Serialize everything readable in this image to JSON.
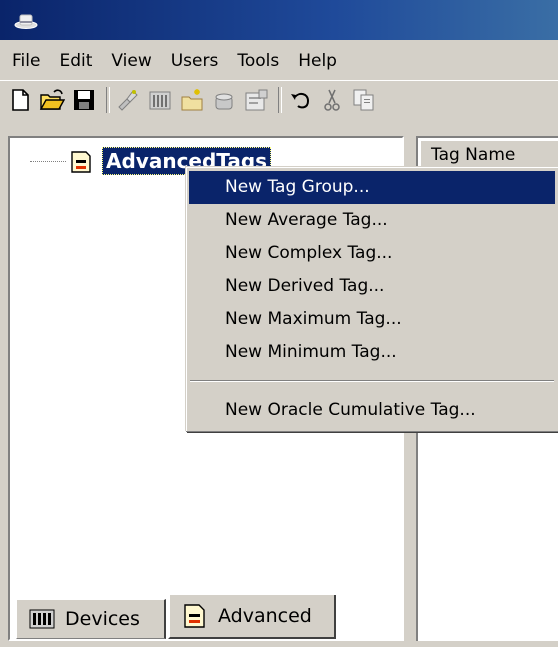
{
  "titlebar": {
    "icon": "app-hat-icon",
    "color": "#0a246a"
  },
  "menubar": {
    "items": [
      {
        "label": "File"
      },
      {
        "label": "Edit"
      },
      {
        "label": "View"
      },
      {
        "label": "Users"
      },
      {
        "label": "Tools"
      },
      {
        "label": "Help"
      }
    ]
  },
  "toolbar": {
    "buttons": [
      {
        "icon": "new-document-icon"
      },
      {
        "icon": "open-folder-icon"
      },
      {
        "icon": "save-disk-icon"
      },
      {
        "icon": "new-device-icon"
      },
      {
        "icon": "new-group-icon"
      },
      {
        "icon": "new-tag-folder-icon"
      },
      {
        "icon": "new-tag-icon"
      },
      {
        "icon": "properties-icon"
      },
      {
        "icon": "undo-icon"
      },
      {
        "icon": "cut-icon"
      },
      {
        "icon": "copy-icon"
      }
    ]
  },
  "tree": {
    "root": {
      "label": "AdvancedTags",
      "icon": "tag-group-icon",
      "selected": true
    }
  },
  "tabs": [
    {
      "label": "Devices",
      "icon": "devices-icon",
      "active": false
    },
    {
      "label": "Advanced",
      "icon": "advanced-icon",
      "active": true
    }
  ],
  "list": {
    "columns": [
      {
        "label": "Tag Name"
      }
    ]
  },
  "context_menu": {
    "items": [
      {
        "label": "New Tag Group...",
        "highlighted": true
      },
      {
        "label": "New Average Tag..."
      },
      {
        "label": "New Complex Tag..."
      },
      {
        "label": "New Derived Tag..."
      },
      {
        "label": "New Maximum Tag..."
      },
      {
        "label": "New Minimum Tag..."
      }
    ],
    "after_separator": [
      {
        "label": "New Oracle Cumulative Tag..."
      }
    ],
    "highlight_color": "#0a246a"
  }
}
